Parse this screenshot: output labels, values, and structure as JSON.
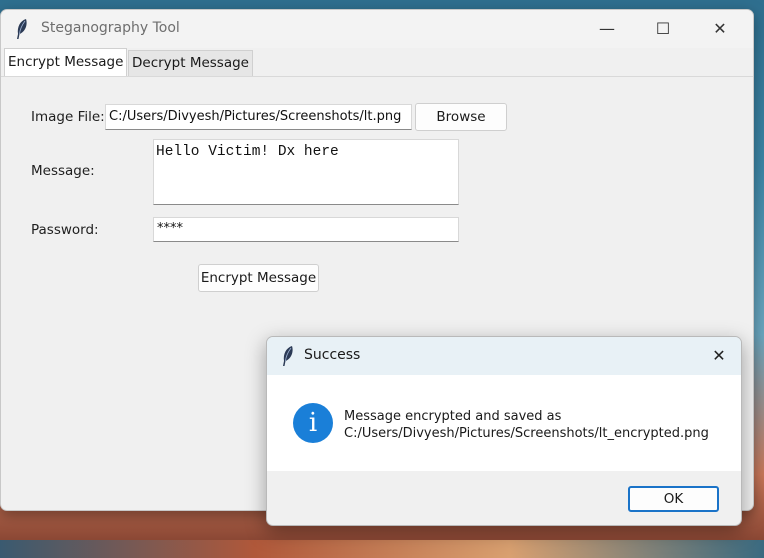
{
  "window": {
    "title": "Steganography Tool",
    "controls": {
      "minimize": "—",
      "maximize": "☐",
      "close": "✕"
    }
  },
  "tabs": [
    {
      "label": "Encrypt Message",
      "active": true
    },
    {
      "label": "Decrypt Message",
      "active": false
    }
  ],
  "form": {
    "image_file_label": "Image File:",
    "image_file_value": "C:/Users/Divyesh/Pictures/Screenshots/lt.png",
    "browse_label": "Browse",
    "message_label": "Message:",
    "message_value": "Hello Victim! Dx here",
    "password_label": "Password:",
    "password_value": "****",
    "encrypt_button_label": "Encrypt Message"
  },
  "dialog": {
    "title": "Success",
    "close": "✕",
    "icon": "info-icon",
    "icon_glyph": "i",
    "message_line1": "Message encrypted and saved as",
    "message_line2": "C:/Users/Divyesh/Pictures/Screenshots/lt_encrypted.png",
    "ok_label": "OK"
  },
  "colors": {
    "accent": "#1a73c8",
    "info_icon": "#1a7fd8",
    "dialog_title_bg": "#e8f1f6"
  }
}
